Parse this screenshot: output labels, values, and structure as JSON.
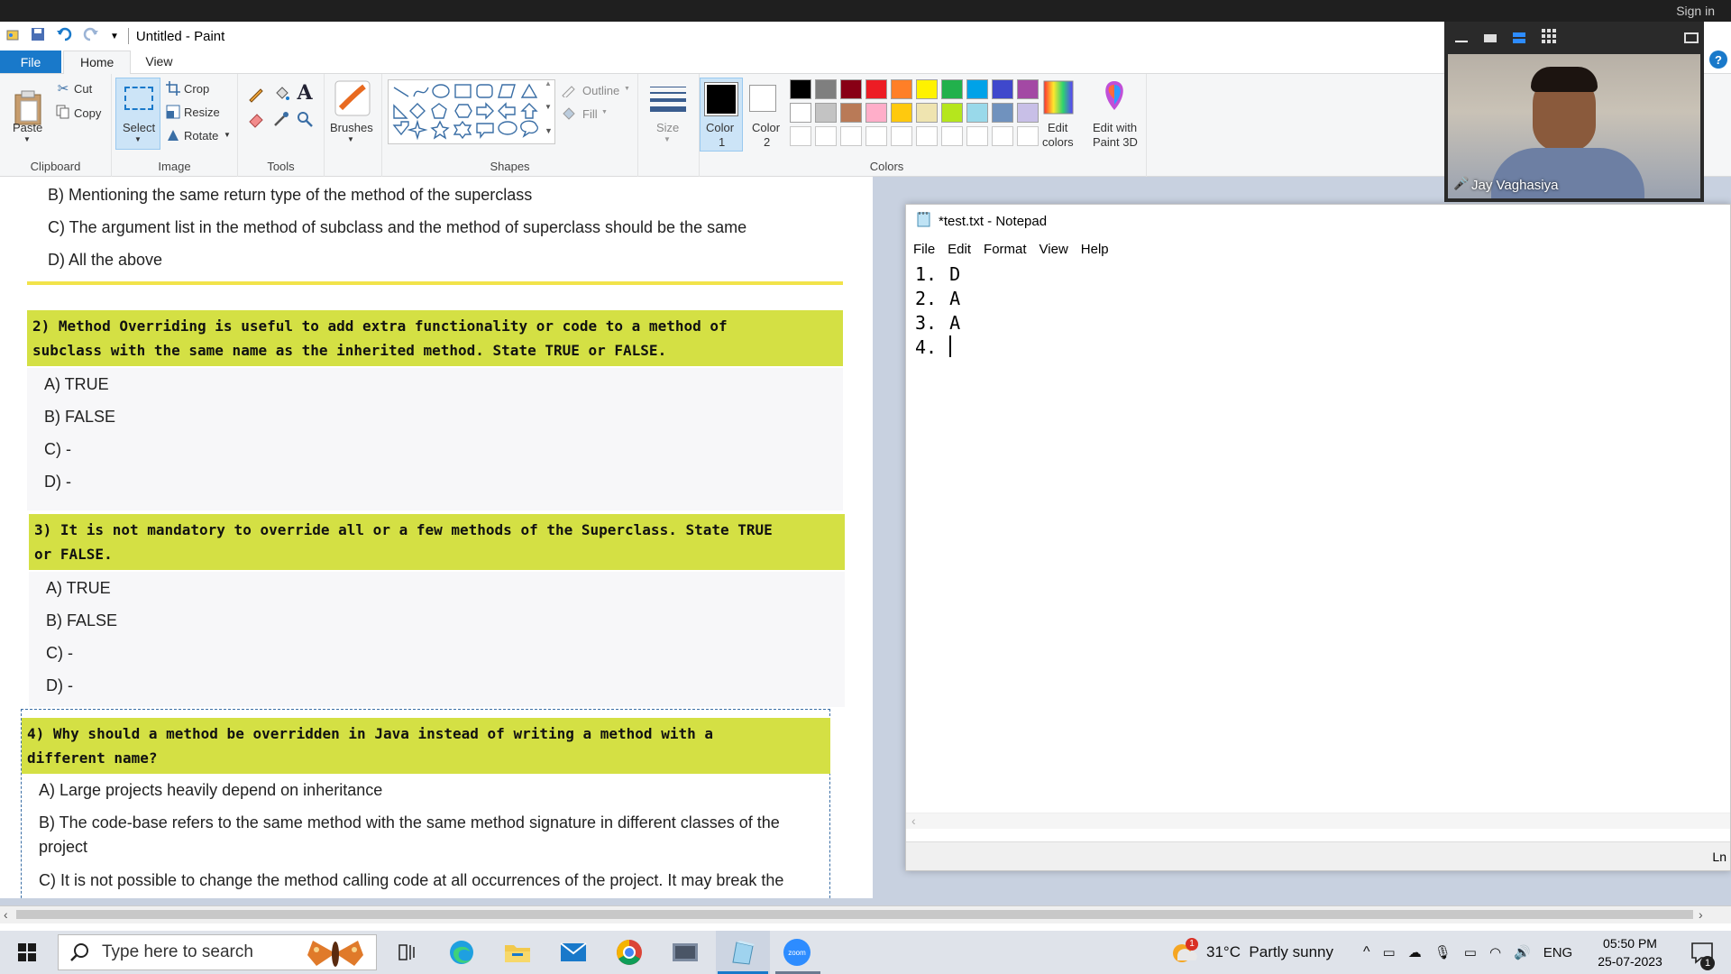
{
  "paint": {
    "title": "Untitled - Paint",
    "tabs": [
      "File",
      "Home",
      "View"
    ],
    "clipboard": {
      "paste": "Paste",
      "cut": "Cut",
      "copy": "Copy",
      "label": "Clipboard"
    },
    "image": {
      "select": "Select",
      "crop": "Crop",
      "resize": "Resize",
      "rotate": "Rotate",
      "label": "Image"
    },
    "tools": {
      "label": "Tools"
    },
    "brushes": "Brushes",
    "shapes": {
      "outline": "Outline",
      "fill": "Fill",
      "label": "Shapes"
    },
    "size": "Size",
    "color1": {
      "line1": "Color",
      "line2": "1"
    },
    "color2": {
      "line1": "Color",
      "line2": "2"
    },
    "colors_label": "Colors",
    "edit_colors": {
      "line1": "Edit",
      "line2": "colors"
    },
    "edit_paint3d": {
      "line1": "Edit with",
      "line2": "Paint 3D"
    },
    "palette_row1": [
      "#000000",
      "#7f7f7f",
      "#880015",
      "#ed1c24",
      "#ff7f27",
      "#fff200",
      "#22b14c",
      "#00a2e8",
      "#3f48cc",
      "#a349a4"
    ],
    "palette_row2": [
      "#ffffff",
      "#c3c3c3",
      "#b97a57",
      "#ffaec9",
      "#ffc90e",
      "#efe4b0",
      "#b5e61d",
      "#99d9ea",
      "#7092be",
      "#c8bfe7"
    ]
  },
  "document": {
    "q1_options": [
      "B) Mentioning the same return type of the method of the superclass",
      "C) The argument list in the method of subclass and the method of superclass should be the same",
      "D) All the above"
    ],
    "q2": {
      "line1": "2) Method Overriding is useful to add extra functionality or code to a method of",
      "line2": "subclass with the same name as the inherited method. State TRUE or FALSE.",
      "options": [
        "A) TRUE",
        "B) FALSE",
        "C) -",
        "D) -"
      ]
    },
    "q3": {
      "line1": "3) It is not mandatory to override all or a few methods of the Superclass. State TRUE",
      "line2": "or FALSE.",
      "options": [
        "A) TRUE",
        "B) FALSE",
        "C) -",
        "D) -"
      ]
    },
    "q4": {
      "line1": "4) Why should a method be overridden in Java instead of writing a method with a",
      "line2": "different name?",
      "options": [
        "A) Large projects heavily depend on inheritance",
        "B) The code-base refers to the same method with the same method signature in different classes of the",
        "project",
        "C) It is not possible to change the method calling code at all occurrences of the project. It may break the"
      ]
    }
  },
  "notepad": {
    "title": "*test.txt - Notepad",
    "menu": [
      "File",
      "Edit",
      "Format",
      "View",
      "Help"
    ],
    "lines": [
      {
        "num": "1.",
        "ans": "D"
      },
      {
        "num": "2.",
        "ans": "A"
      },
      {
        "num": "3.",
        "ans": "A"
      },
      {
        "num": "4.",
        "ans": ""
      }
    ],
    "status": "Ln"
  },
  "zoom": {
    "participant": "Jay Vaghasiya",
    "sign_in": "Sign in"
  },
  "taskbar": {
    "search_placeholder": "Type here to search",
    "weather": "31°C  Partly sunny",
    "weather_badge": "1",
    "language": "ENG",
    "time": "05:50 PM",
    "date": "25-07-2023",
    "zoom_label": "zoom",
    "notification_count": "1"
  }
}
